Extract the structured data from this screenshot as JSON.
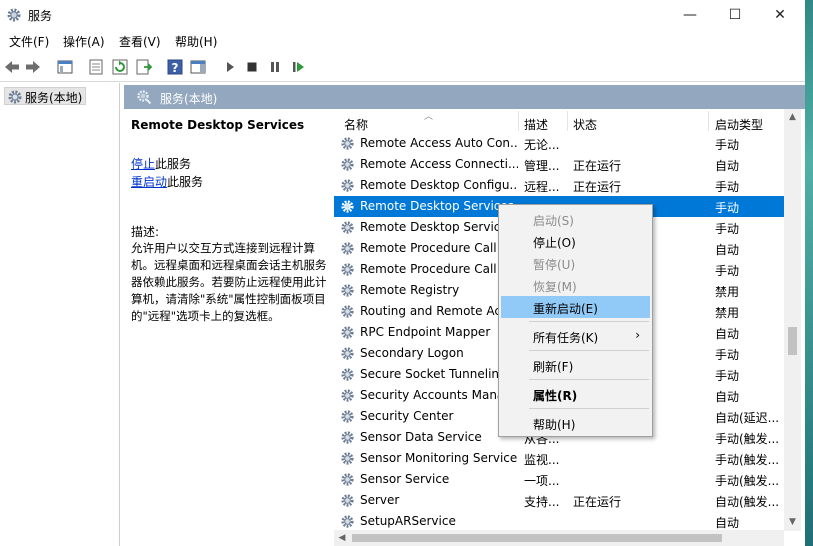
{
  "window": {
    "title": "服务",
    "minimize_glyph": "—",
    "maximize_glyph": "☐",
    "close_glyph": "✕"
  },
  "menubar": [
    "文件(F)",
    "操作(A)",
    "查看(V)",
    "帮助(H)"
  ],
  "tree": {
    "root_label": "服务(本地)"
  },
  "pane_header": {
    "label": "服务(本地)"
  },
  "description_panel": {
    "service_name": "Remote Desktop Services",
    "stop_link": "停止",
    "stop_suffix": "此服务",
    "restart_link": "重启动",
    "restart_suffix": "此服务",
    "description_label": "描述:",
    "description_text": "允许用户以交互方式连接到远程计算机。远程桌面和远程桌面会话主机服务器依赖此服务。若要防止远程使用此计算机，请清除\"系统\"属性控制面板项目的\"远程\"选项卡上的复选框。"
  },
  "columns": {
    "name": "名称",
    "desc": "描述",
    "status": "状态",
    "startup": "启动类型"
  },
  "rows": [
    {
      "name": "Remote Access Auto Con...",
      "desc": "无论...",
      "status": "",
      "startup": "手动"
    },
    {
      "name": "Remote Access Connecti...",
      "desc": "管理...",
      "status": "正在运行",
      "startup": "自动"
    },
    {
      "name": "Remote Desktop Configu...",
      "desc": "远程...",
      "status": "正在运行",
      "startup": "手动"
    },
    {
      "name": "Remote Desktop Services",
      "desc": "",
      "status": "",
      "startup": "手动",
      "selected": true
    },
    {
      "name": "Remote Desktop Servic",
      "desc": "",
      "status": "",
      "startup": "手动"
    },
    {
      "name": "Remote Procedure Call",
      "desc": "",
      "status": "",
      "startup": "自动"
    },
    {
      "name": "Remote Procedure Call",
      "desc": "",
      "status": "",
      "startup": "手动"
    },
    {
      "name": "Remote Registry",
      "desc": "",
      "status": "",
      "startup": "禁用"
    },
    {
      "name": "Routing and Remote Ac",
      "desc": "",
      "status": "",
      "startup": "禁用"
    },
    {
      "name": "RPC Endpoint Mapper",
      "desc": "",
      "status": "",
      "startup": "自动"
    },
    {
      "name": "Secondary Logon",
      "desc": "",
      "status": "",
      "startup": "手动"
    },
    {
      "name": "Secure Socket Tunneling",
      "desc": "",
      "status": "",
      "startup": "手动"
    },
    {
      "name": "Security Accounts Mana",
      "desc": "",
      "status": "",
      "startup": "自动"
    },
    {
      "name": "Security Center",
      "desc": "",
      "status": "",
      "startup": "自动(延迟..."
    },
    {
      "name": "Sensor Data Service",
      "desc": "从各...",
      "status": "",
      "startup": "手动(触发..."
    },
    {
      "name": "Sensor Monitoring Service",
      "desc": "监视...",
      "status": "",
      "startup": "手动(触发..."
    },
    {
      "name": "Sensor Service",
      "desc": "一项...",
      "status": "",
      "startup": "手动(触发..."
    },
    {
      "name": "Server",
      "desc": "支持...",
      "status": "正在运行",
      "startup": "自动(触发..."
    },
    {
      "name": "SetupARService",
      "desc": "",
      "status": "",
      "startup": "自动"
    }
  ],
  "context_menu": {
    "start": "启动(S)",
    "stop": "停止(O)",
    "pause": "暂停(U)",
    "resume": "恢复(M)",
    "restart": "重新启动(E)",
    "all_tasks": "所有任务(K)",
    "refresh": "刷新(F)",
    "properties": "属性(R)",
    "help": "帮助(H)"
  }
}
